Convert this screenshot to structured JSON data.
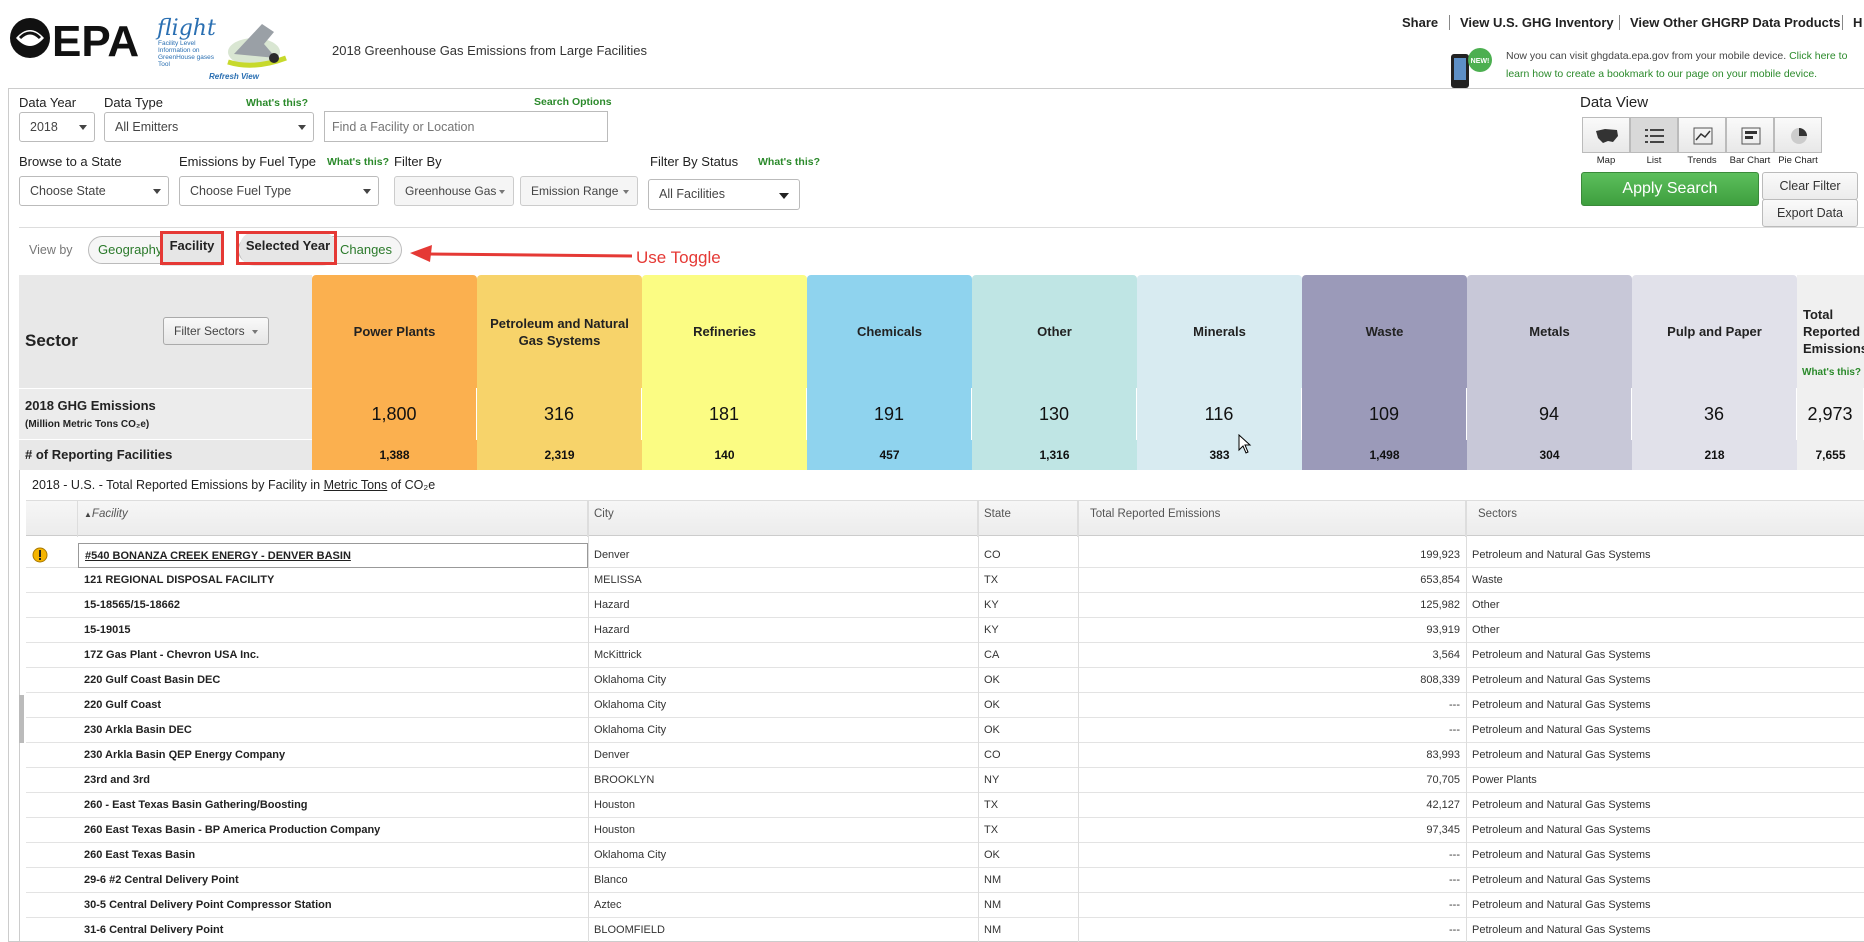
{
  "header": {
    "brand": "EPA",
    "flight_word": "flight",
    "flight_sub": "Facility Level Information on GreenHouse gases Tool",
    "refresh_view": "Refresh View",
    "page_title": "2018 Greenhouse Gas Emissions from Large Facilities",
    "links": [
      "Share",
      "View U.S. GHG Inventory",
      "View Other GHGRP Data Products",
      "H"
    ],
    "mobile_badge": "NEW!",
    "mobile_text_1": "Now you can visit ghgdata.epa.gov from your mobile device.",
    "mobile_link_1": "Click here to",
    "mobile_link_2": "learn how to create a bookmark to our page on your mobile device."
  },
  "filters": {
    "data_year_label": "Data Year",
    "data_year_value": "2018",
    "data_type_label": "Data Type",
    "data_type_help": "What's this?",
    "data_type_value": "All Emitters",
    "search_options": "Search Options",
    "search_placeholder": "Find a Facility or Location",
    "browse_state_label": "Browse to a State",
    "browse_state_value": "Choose State",
    "fuel_type_label": "Emissions by Fuel Type",
    "fuel_type_help": "What's this?",
    "fuel_type_value": "Choose Fuel Type",
    "filter_by_label": "Filter By",
    "greenhouse_gas": "Greenhouse Gas",
    "emission_range": "Emission Range",
    "status_label": "Filter By Status",
    "status_help": "What's this?",
    "status_value": "All Facilities"
  },
  "data_view": {
    "title": "Data View",
    "buttons": [
      "Map",
      "List",
      "Trends",
      "Bar Chart",
      "Pie Chart"
    ],
    "active": "List",
    "apply": "Apply Search",
    "clear": "Clear Filter",
    "export": "Export Data"
  },
  "view_by": {
    "label": "View by",
    "geography": "Geography",
    "facility": "Facility",
    "selected_year": "Selected Year",
    "changes": "Changes",
    "annotation": "Use Toggle"
  },
  "sectors": {
    "header": "Sector",
    "filter_button": "Filter Sectors",
    "ghg_label": "2018 GHG Emissions",
    "ghg_unit": "(Million Metric Tons CO₂e)",
    "count_label": "# of Reporting Facilities",
    "total_help": "What's this?",
    "items": [
      {
        "name": "Power Plants",
        "emissions": "1,800",
        "facilities": "1,388",
        "color": "#fbb04f"
      },
      {
        "name": "Petroleum and Natural Gas Systems",
        "emissions": "316",
        "facilities": "2,319",
        "color": "#f7d36a"
      },
      {
        "name": "Refineries",
        "emissions": "181",
        "facilities": "140",
        "color": "#fbfc83"
      },
      {
        "name": "Chemicals",
        "emissions": "191",
        "facilities": "457",
        "color": "#8fd3ee"
      },
      {
        "name": "Other",
        "emissions": "130",
        "facilities": "1,316",
        "color": "#bfe5e4"
      },
      {
        "name": "Minerals",
        "emissions": "116",
        "facilities": "383",
        "color": "#d8ebf1"
      },
      {
        "name": "Waste",
        "emissions": "109",
        "facilities": "1,498",
        "color": "#9b9ab9"
      },
      {
        "name": "Metals",
        "emissions": "94",
        "facilities": "304",
        "color": "#c8c8d8"
      },
      {
        "name": "Pulp and Paper",
        "emissions": "36",
        "facilities": "218",
        "color": "#e1e1ea"
      },
      {
        "name": "Total Reported Emissions",
        "emissions": "2,973",
        "facilities": "7,655",
        "color": "#f0f0f0"
      }
    ]
  },
  "table": {
    "caption_pre": "2018 - U.S. - Total Reported Emissions by Facility in ",
    "caption_link": "Metric Tons",
    "caption_post": " of CO₂e",
    "columns": [
      "Facility",
      "City",
      "State",
      "Total Reported Emissions",
      "Sectors"
    ],
    "rows": [
      {
        "facility": "#540 BONANZA CREEK ENERGY - DENVER BASIN",
        "city": "Denver",
        "state": "CO",
        "emissions": "199,923",
        "sectors": "Petroleum and Natural Gas Systems",
        "warn": true
      },
      {
        "facility": "121 REGIONAL DISPOSAL FACILITY",
        "city": "MELISSA",
        "state": "TX",
        "emissions": "653,854",
        "sectors": "Waste"
      },
      {
        "facility": "15-18565/15-18662",
        "city": "Hazard",
        "state": "KY",
        "emissions": "125,982",
        "sectors": "Other"
      },
      {
        "facility": "15-19015",
        "city": "Hazard",
        "state": "KY",
        "emissions": "93,919",
        "sectors": "Other"
      },
      {
        "facility": "17Z Gas Plant - Chevron USA Inc.",
        "city": "McKittrick",
        "state": "CA",
        "emissions": "3,564",
        "sectors": "Petroleum and Natural Gas Systems"
      },
      {
        "facility": "220 Gulf Coast Basin DEC",
        "city": "Oklahoma City",
        "state": "OK",
        "emissions": "808,339",
        "sectors": "Petroleum and Natural Gas Systems"
      },
      {
        "facility": "220 Gulf Coast",
        "city": "Oklahoma City",
        "state": "OK",
        "emissions": "---",
        "sectors": "Petroleum and Natural Gas Systems"
      },
      {
        "facility": "230 Arkla Basin DEC",
        "city": "Oklahoma City",
        "state": "OK",
        "emissions": "---",
        "sectors": "Petroleum and Natural Gas Systems"
      },
      {
        "facility": "230 Arkla Basin QEP Energy Company",
        "city": "Denver",
        "state": "CO",
        "emissions": "83,993",
        "sectors": "Petroleum and Natural Gas Systems"
      },
      {
        "facility": "23rd and 3rd",
        "city": "BROOKLYN",
        "state": "NY",
        "emissions": "70,705",
        "sectors": "Power Plants"
      },
      {
        "facility": "260 - East Texas Basin Gathering/Boosting",
        "city": "Houston",
        "state": "TX",
        "emissions": "42,127",
        "sectors": "Petroleum and Natural Gas Systems"
      },
      {
        "facility": "260 East Texas Basin - BP America Production Company",
        "city": "Houston",
        "state": "TX",
        "emissions": "97,345",
        "sectors": "Petroleum and Natural Gas Systems"
      },
      {
        "facility": "260 East Texas Basin",
        "city": "Oklahoma City",
        "state": "OK",
        "emissions": "---",
        "sectors": "Petroleum and Natural Gas Systems"
      },
      {
        "facility": "29-6 #2 Central Delivery Point",
        "city": "Blanco",
        "state": "NM",
        "emissions": "---",
        "sectors": "Petroleum and Natural Gas Systems"
      },
      {
        "facility": "30-5 Central Delivery Point Compressor Station",
        "city": "Aztec",
        "state": "NM",
        "emissions": "---",
        "sectors": "Petroleum and Natural Gas Systems"
      },
      {
        "facility": "31-6 Central Delivery Point",
        "city": "BLOOMFIELD",
        "state": "NM",
        "emissions": "---",
        "sectors": "Petroleum and Natural Gas Systems"
      }
    ]
  }
}
